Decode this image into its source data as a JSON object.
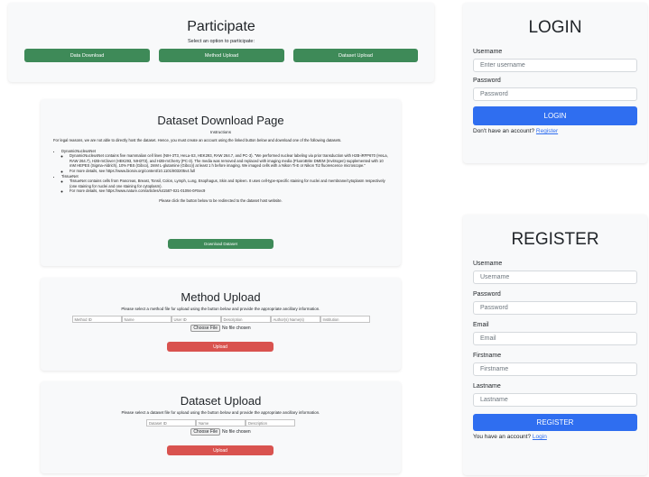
{
  "participate": {
    "title": "Participate",
    "subtitle": "Select an option to participate:",
    "buttons": [
      "Data Download",
      "Method Upload",
      "Dataset Upload"
    ]
  },
  "download_page": {
    "title": "Dataset Download Page",
    "instructions_label": "Instructions",
    "intro": "For legal reasons, we are not able to directly host the dataset. Hence, you must create an account using the linked button below and download one of the following datasets.",
    "datasets": [
      {
        "name": "DynamicNucleusNet",
        "bullets": [
          "DynamicNucleusNet contains five mammalian cell lines (NIH-3T3, HeLa-S3, HEK293, RAW 264.7, and PC-3). \"We performed nuclear labeling via prior transduction with H2B-iRFP670 (HeLa, RAW 264.7), H2B-mClover (HEK293, NIH3T3), and H2B-mCherry (PC-3). The media was removed and replaced with imaging media (FluoroBrite DMEM (Invitrogen) supplemented with 10 mM HEPES (Sigma-Aldrich), 10% FBS (Gibco), 2mM L-glutamine (Gibco)) at least 1 h before imaging. We imaged cells with a Nikon Ti-E or Nikon Ti2 fluorescence microscope.\"",
          "For more details, see https://www.biorxiv.org/content/10.1101/803205v4.full"
        ]
      },
      {
        "name": "TissueNet",
        "bullets": [
          "TissueNet contains cells from Pancreas, Breast, Tonsil, Colon, Lymph, Lung, Esophagus, Skin and Spleen. It uses cell-type-specific staining for nuclei and membrane/cytoplasm respectively (one staining for nuclei and one staining for cytoplasm).",
          "For more details, see https://www.nature.com/articles/s41587-021-01094-0#Sec9"
        ]
      }
    ],
    "redirect_note": "Please click the button below to be redirected to the dataset host website.",
    "download_button": "Download Dataset"
  },
  "method_upload": {
    "title": "Method Upload",
    "subtitle": "Please select a method file for upload using the button below and provide the appropriate ancillary information.",
    "fields": [
      "Method ID",
      "Name",
      "User ID",
      "Description",
      "Author(s) Name(s)",
      "Institution"
    ],
    "choose_file": "Choose File",
    "no_file": "No file chosen",
    "upload_button": "Upload"
  },
  "dataset_upload": {
    "title": "Dataset Upload",
    "subtitle": "Please select a dataset file for upload using the button below and provide the appropriate ancillary information.",
    "fields": [
      "Dataset ID",
      "Name",
      "Description"
    ],
    "choose_file": "Choose File",
    "no_file": "No file chosen",
    "upload_button": "Upload"
  },
  "login": {
    "title": "LOGIN",
    "username_label": "Username",
    "username_placeholder": "Enter username",
    "password_label": "Password",
    "password_placeholder": "Password",
    "button": "LOGIN",
    "footer_text": "Don't have an account?",
    "footer_link": "Register"
  },
  "register": {
    "title": "REGISTER",
    "fields": [
      {
        "label": "Username",
        "placeholder": "Username"
      },
      {
        "label": "Password",
        "placeholder": "Password"
      },
      {
        "label": "Email",
        "placeholder": "Email"
      },
      {
        "label": "Firstname",
        "placeholder": "Firstname"
      },
      {
        "label": "Lastname",
        "placeholder": "Lastname"
      }
    ],
    "button": "REGISTER",
    "footer_text": "You have an account?",
    "footer_link": "Login"
  },
  "colors": {
    "green": "#3e8a58",
    "red": "#d9534f",
    "blue": "#2f6ef0",
    "card": "#f8f9fa"
  }
}
